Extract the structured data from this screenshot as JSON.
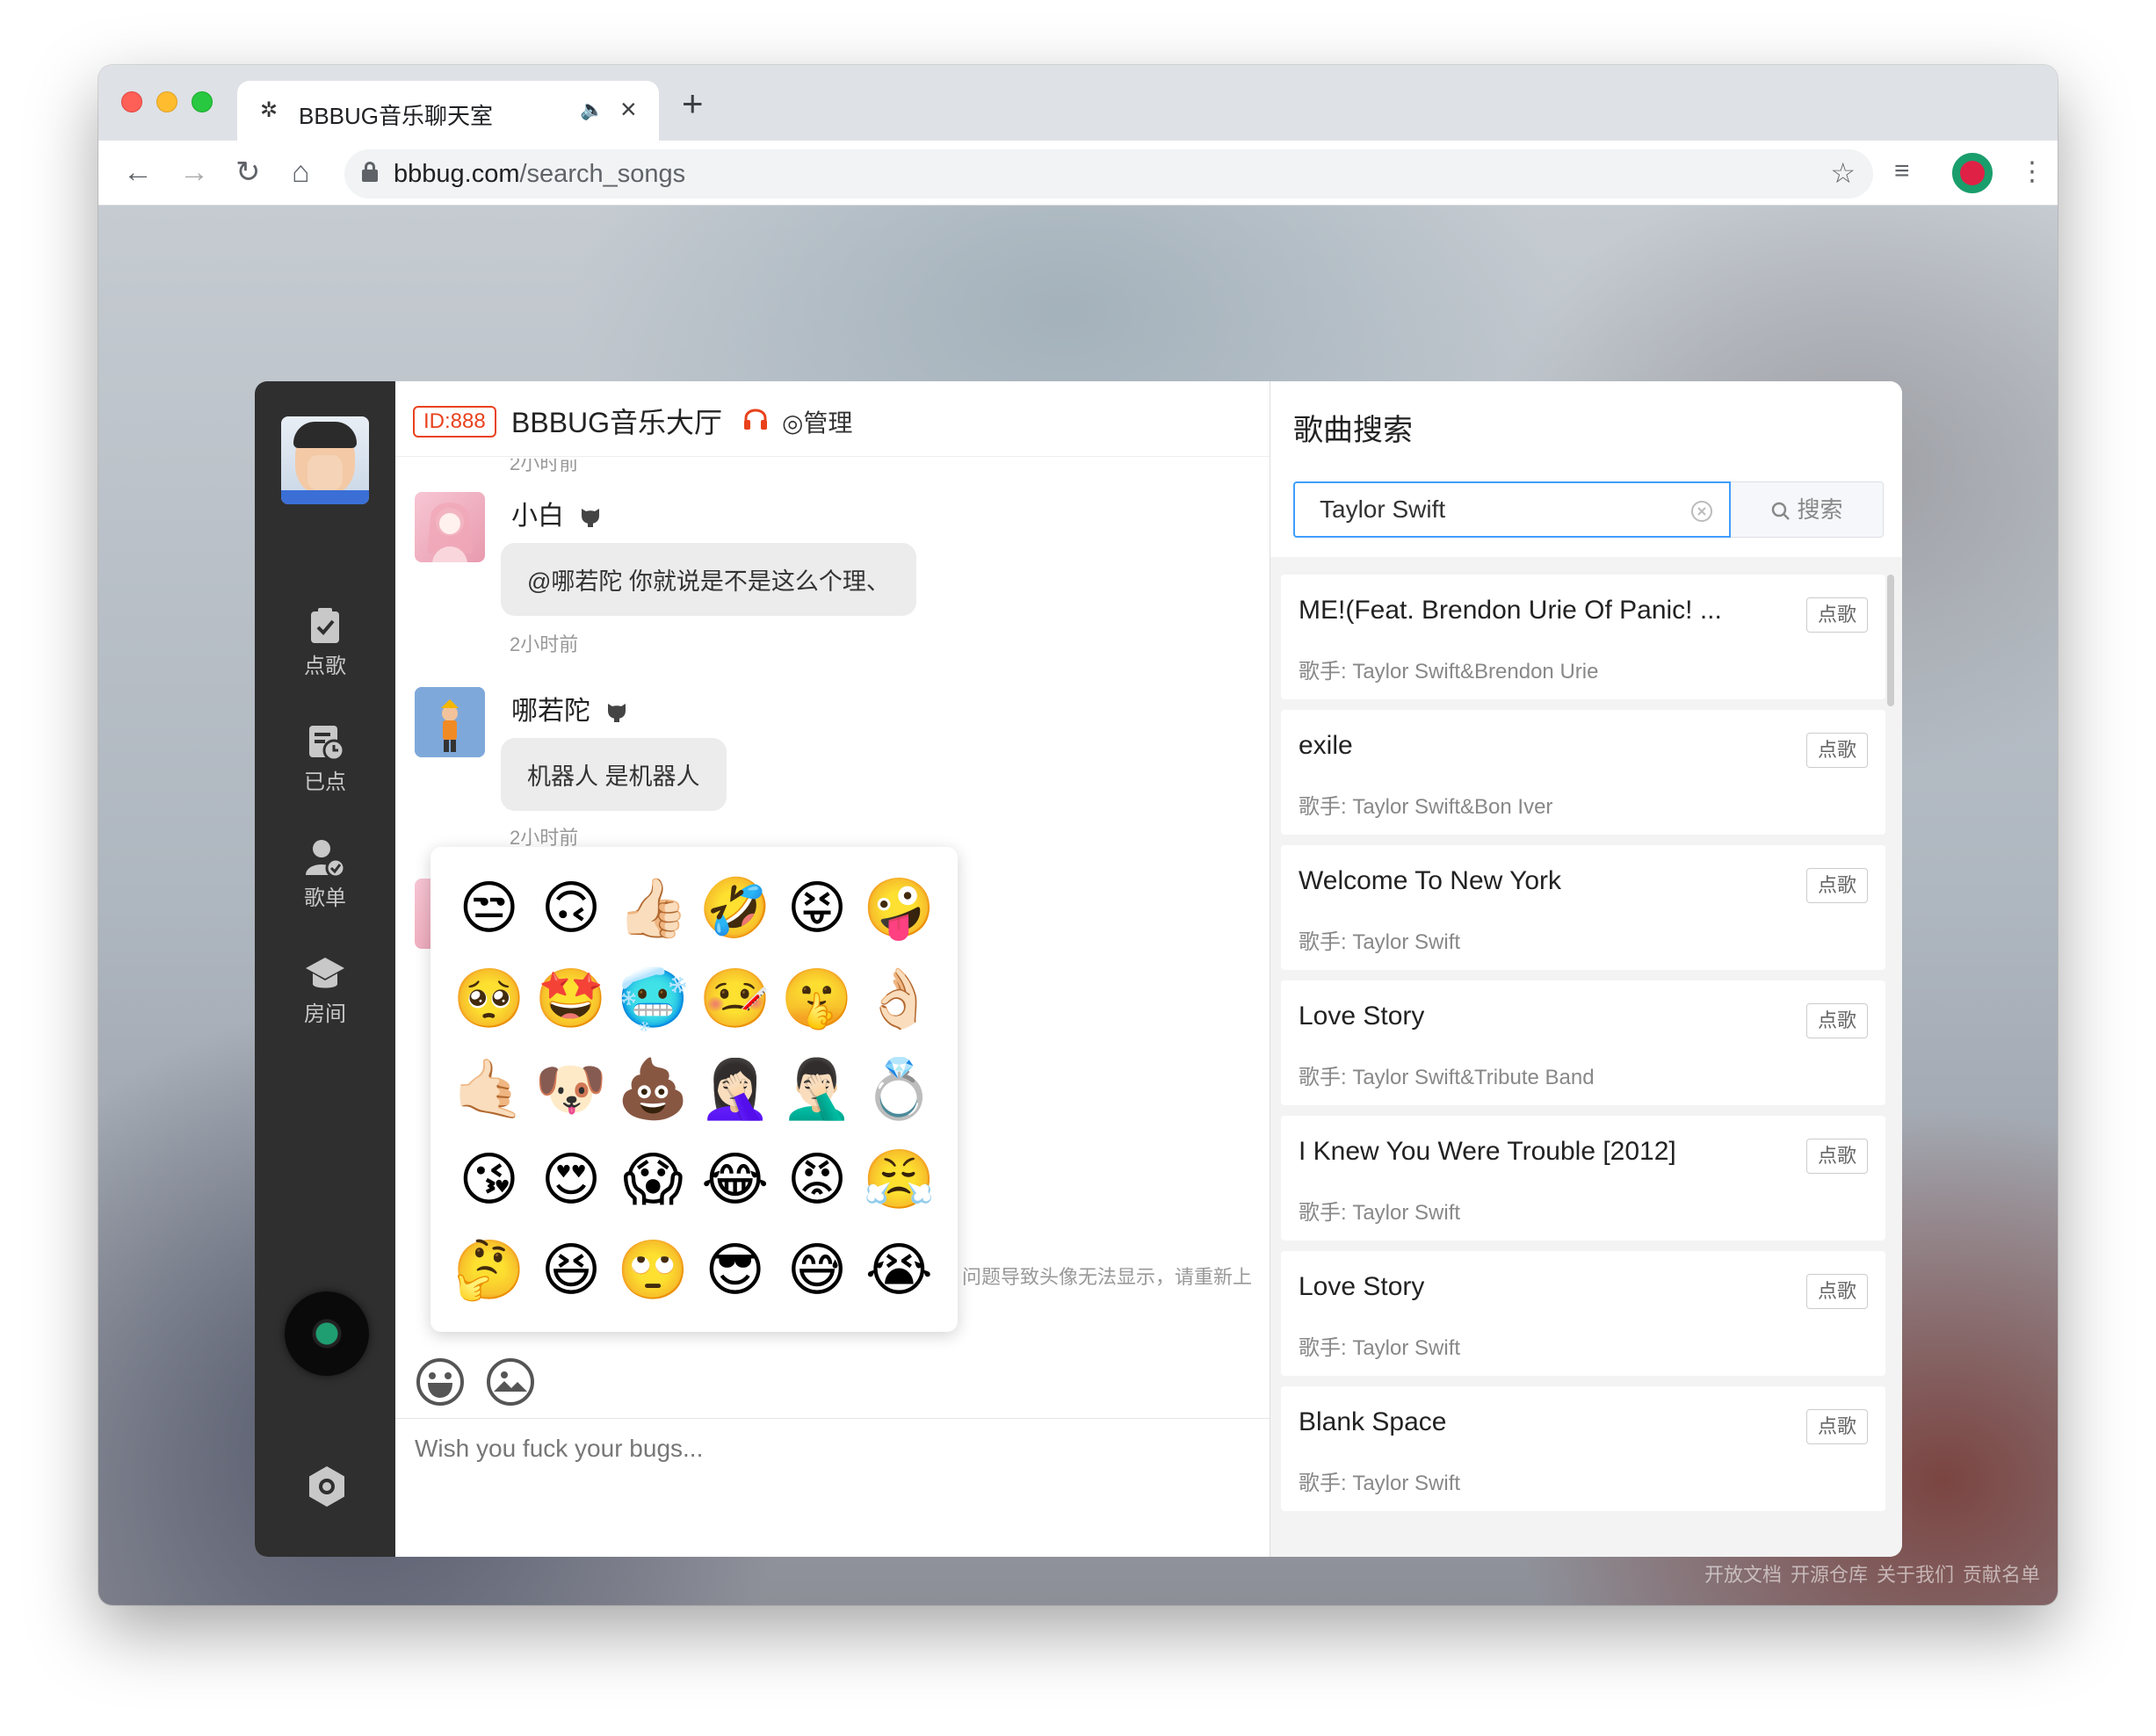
{
  "browser": {
    "tab_title": "BBBUG音乐聊天室",
    "url_host": "bbbug.com",
    "url_path": "/search_songs"
  },
  "sidebar": {
    "items": [
      {
        "label": "点歌",
        "icon": "clipboard-check-icon"
      },
      {
        "label": "已点",
        "icon": "list-clock-icon"
      },
      {
        "label": "歌单",
        "icon": "user-check-icon"
      },
      {
        "label": "房间",
        "icon": "graduation-cap-icon"
      }
    ]
  },
  "chat": {
    "room_id": "ID:888",
    "room_name": "BBBUG音乐大厅",
    "admin_label": "◎管理",
    "top_time": "2小时前",
    "messages": [
      {
        "user": "小白",
        "text": "@哪若陀 你就说是不是这么个理、",
        "time": "2小时前"
      },
      {
        "user": "哪若陀",
        "text": "机器人 是机器人",
        "time": "2小时前"
      }
    ],
    "notice": "问题导致头像无法显示，请重新上",
    "input_placeholder": "Wish you fuck your bugs..."
  },
  "emojis": [
    "😒",
    "🙃",
    "👍🏻",
    "🤣",
    "😝",
    "🤪",
    "🥺",
    "🤩",
    "🥶",
    "🤒",
    "🤫",
    "👌🏻",
    "🤙🏻",
    "🐶",
    "💩",
    "🤦🏻‍♀️",
    "🤦🏻‍♂️",
    "💍",
    "😘",
    "😍",
    "😱",
    "😂",
    "😡",
    "😤",
    "🤔",
    "😆",
    "🙄",
    "😎",
    "😅",
    "😭"
  ],
  "search": {
    "title": "歌曲搜索",
    "query": "Taylor Swift",
    "button_label": "搜索",
    "order_label": "点歌",
    "artist_prefix": "歌手: ",
    "results": [
      {
        "title": "ME!(Feat. Brendon Urie Of Panic! ...",
        "artist": "歌手: Taylor Swift&Brendon Urie"
      },
      {
        "title": "exile",
        "artist": "歌手: Taylor Swift&Bon Iver"
      },
      {
        "title": "Welcome To New York",
        "artist": "歌手: Taylor Swift"
      },
      {
        "title": "Love Story",
        "artist": "歌手: Taylor Swift&Tribute Band"
      },
      {
        "title": "I Knew You Were Trouble [2012]",
        "artist": "歌手: Taylor Swift"
      },
      {
        "title": "Love Story",
        "artist": "歌手: Taylor Swift"
      },
      {
        "title": "Blank Space",
        "artist": "歌手: Taylor Swift"
      }
    ]
  },
  "footer": {
    "links": [
      "开放文档",
      "开源仓库",
      "关于我们",
      "贡献名单"
    ]
  }
}
